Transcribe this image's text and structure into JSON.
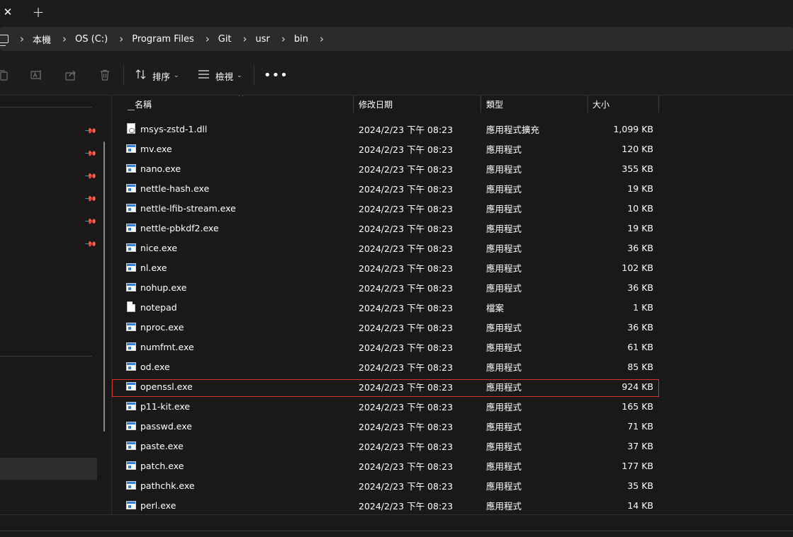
{
  "titlebar": {
    "close_glyph": "✕",
    "new_tab_glyph": "+"
  },
  "breadcrumb": [
    "本機",
    "OS (C:)",
    "Program Files",
    "Git",
    "usr",
    "bin"
  ],
  "toolbar": {
    "sort_label": "排序",
    "view_label": "檢視",
    "more_glyph": "•••",
    "icons": [
      "copy-icon",
      "rename-icon",
      "share-icon",
      "delete-icon",
      "sort-icon",
      "view-icon",
      "more-icon"
    ]
  },
  "columns": {
    "name": "名稱",
    "date": "修改日期",
    "type": "類型",
    "size": "大小"
  },
  "files": [
    {
      "name": "msys-zstd-1.dll",
      "date": "2024/2/23 下午 08:23",
      "type": "應用程式擴充",
      "size": "1,099 KB",
      "icon": "dll"
    },
    {
      "name": "mv.exe",
      "date": "2024/2/23 下午 08:23",
      "type": "應用程式",
      "size": "120 KB",
      "icon": "exe"
    },
    {
      "name": "nano.exe",
      "date": "2024/2/23 下午 08:23",
      "type": "應用程式",
      "size": "355 KB",
      "icon": "exe"
    },
    {
      "name": "nettle-hash.exe",
      "date": "2024/2/23 下午 08:23",
      "type": "應用程式",
      "size": "19 KB",
      "icon": "exe"
    },
    {
      "name": "nettle-lfib-stream.exe",
      "date": "2024/2/23 下午 08:23",
      "type": "應用程式",
      "size": "10 KB",
      "icon": "exe"
    },
    {
      "name": "nettle-pbkdf2.exe",
      "date": "2024/2/23 下午 08:23",
      "type": "應用程式",
      "size": "19 KB",
      "icon": "exe"
    },
    {
      "name": "nice.exe",
      "date": "2024/2/23 下午 08:23",
      "type": "應用程式",
      "size": "36 KB",
      "icon": "exe"
    },
    {
      "name": "nl.exe",
      "date": "2024/2/23 下午 08:23",
      "type": "應用程式",
      "size": "102 KB",
      "icon": "exe"
    },
    {
      "name": "nohup.exe",
      "date": "2024/2/23 下午 08:23",
      "type": "應用程式",
      "size": "36 KB",
      "icon": "exe"
    },
    {
      "name": "notepad",
      "date": "2024/2/23 下午 08:23",
      "type": "檔案",
      "size": "1 KB",
      "icon": "txt"
    },
    {
      "name": "nproc.exe",
      "date": "2024/2/23 下午 08:23",
      "type": "應用程式",
      "size": "36 KB",
      "icon": "exe"
    },
    {
      "name": "numfmt.exe",
      "date": "2024/2/23 下午 08:23",
      "type": "應用程式",
      "size": "61 KB",
      "icon": "exe"
    },
    {
      "name": "od.exe",
      "date": "2024/2/23 下午 08:23",
      "type": "應用程式",
      "size": "85 KB",
      "icon": "exe"
    },
    {
      "name": "openssl.exe",
      "date": "2024/2/23 下午 08:23",
      "type": "應用程式",
      "size": "924 KB",
      "icon": "exe",
      "highlighted": true
    },
    {
      "name": "p11-kit.exe",
      "date": "2024/2/23 下午 08:23",
      "type": "應用程式",
      "size": "165 KB",
      "icon": "exe"
    },
    {
      "name": "passwd.exe",
      "date": "2024/2/23 下午 08:23",
      "type": "應用程式",
      "size": "71 KB",
      "icon": "exe"
    },
    {
      "name": "paste.exe",
      "date": "2024/2/23 下午 08:23",
      "type": "應用程式",
      "size": "37 KB",
      "icon": "exe"
    },
    {
      "name": "patch.exe",
      "date": "2024/2/23 下午 08:23",
      "type": "應用程式",
      "size": "177 KB",
      "icon": "exe"
    },
    {
      "name": "pathchk.exe",
      "date": "2024/2/23 下午 08:23",
      "type": "應用程式",
      "size": "35 KB",
      "icon": "exe"
    },
    {
      "name": "perl.exe",
      "date": "2024/2/23 下午 08:23",
      "type": "應用程式",
      "size": "14 KB",
      "icon": "exe"
    }
  ],
  "highlight_color": "#d93030",
  "exe_icon_color": "#2f82d6"
}
